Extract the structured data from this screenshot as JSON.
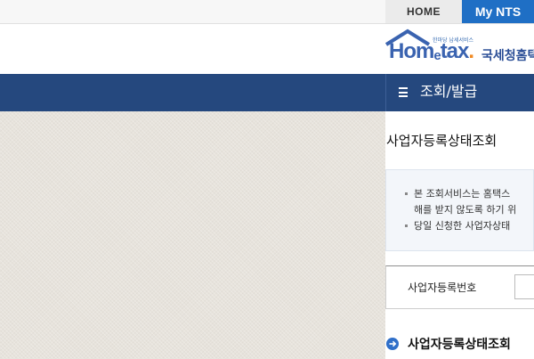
{
  "header": {
    "home_tab": "HOME",
    "mynts_tab": "My NTS"
  },
  "logo": {
    "tagline": "한마당 납세서비스",
    "brand_home": "Hom",
    "brand_e": "e",
    "brand_tax": "tax",
    "brand_dot": ".",
    "brand_kr": "국세청홈택"
  },
  "nav": {
    "menu_label": "조회/발급"
  },
  "page": {
    "title": "사업자등록상태조회",
    "notice": [
      "본 조회서비스는 홈택스",
      "해를 받지 않도록 하기 위",
      "당일 신청한 사업자상태"
    ],
    "form_label": "사업자등록번호",
    "section_title": "사업자등록상태조회"
  },
  "colors": {
    "nav_bg": "#25487e",
    "mynts_bg": "#1f6fc5",
    "accent": "#2f6fc9"
  }
}
